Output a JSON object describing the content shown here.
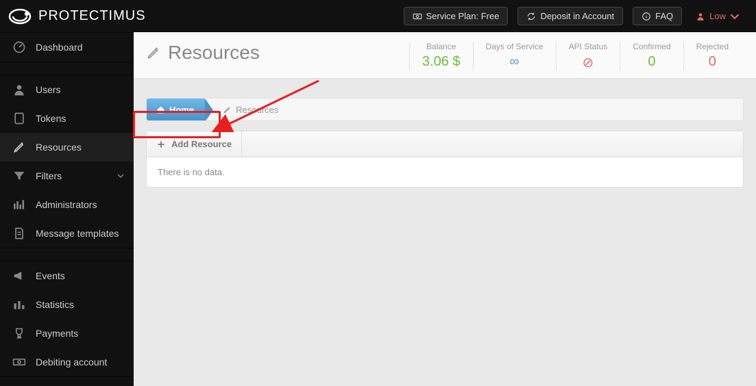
{
  "brand": "PROTECTIMUS",
  "topbar": {
    "service_plan": "Service Plan: Free",
    "deposit": "Deposit in Account",
    "faq": "FAQ",
    "user_name": "Low"
  },
  "sidebar": {
    "dashboard": "Dashboard",
    "users": "Users",
    "tokens": "Tokens",
    "resources": "Resources",
    "filters": "Filters",
    "administrators": "Administrators",
    "templates": "Message templates",
    "events": "Events",
    "statistics": "Statistics",
    "payments": "Payments",
    "debiting": "Debiting account"
  },
  "page": {
    "title": "Resources"
  },
  "stats": {
    "balance_label": "Balance",
    "balance_value": "3.06 $",
    "days_label": "Days of Service",
    "api_label": "API Status",
    "confirmed_label": "Confirmed",
    "confirmed_value": "0",
    "rejected_label": "Rejected",
    "rejected_value": "0"
  },
  "crumbs": {
    "home": "Home",
    "current": "Resources"
  },
  "panel": {
    "add_label": "Add Resource",
    "empty": "There is no data."
  }
}
